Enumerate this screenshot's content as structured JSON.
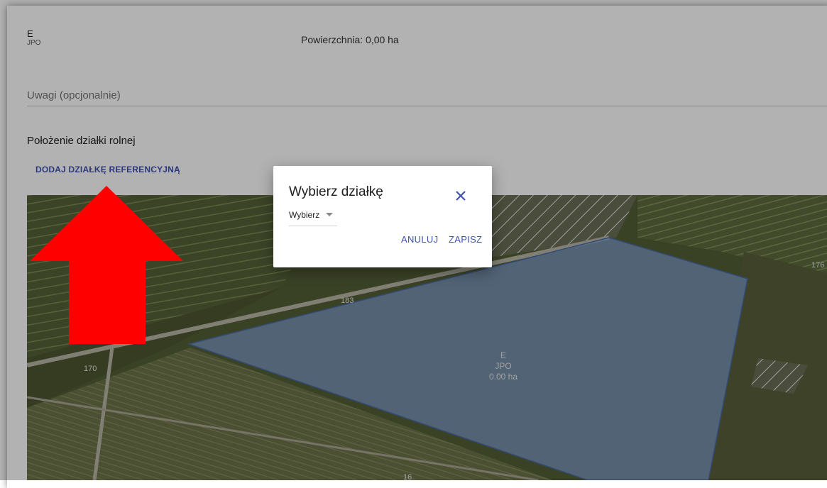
{
  "jpo": {
    "code": "E",
    "type": "JPO"
  },
  "area": {
    "text": "Powierzchnia: 0,00 ha"
  },
  "remarks": {
    "placeholder": "Uwagi (opcjonalnie)"
  },
  "location": {
    "title": "Położenie działki rolnej",
    "add_reference_label": "DODAJ DZIAŁKĘ REFERENCYJNĄ"
  },
  "map": {
    "parcel_labels": [
      "183",
      "170",
      "176",
      "16"
    ],
    "polygon_label": {
      "code": "E",
      "type": "JPO",
      "area": "0.00 ha"
    },
    "polygon_fill": "#7f9fcf"
  },
  "dialog": {
    "title": "Wybierz działkę",
    "select_value": "Wybierz",
    "cancel_label": "ANULUJ",
    "save_label": "ZAPISZ",
    "close_icon": "close-icon"
  },
  "colors": {
    "accent": "#3f51b5",
    "annotation_arrow": "#ff0000"
  }
}
